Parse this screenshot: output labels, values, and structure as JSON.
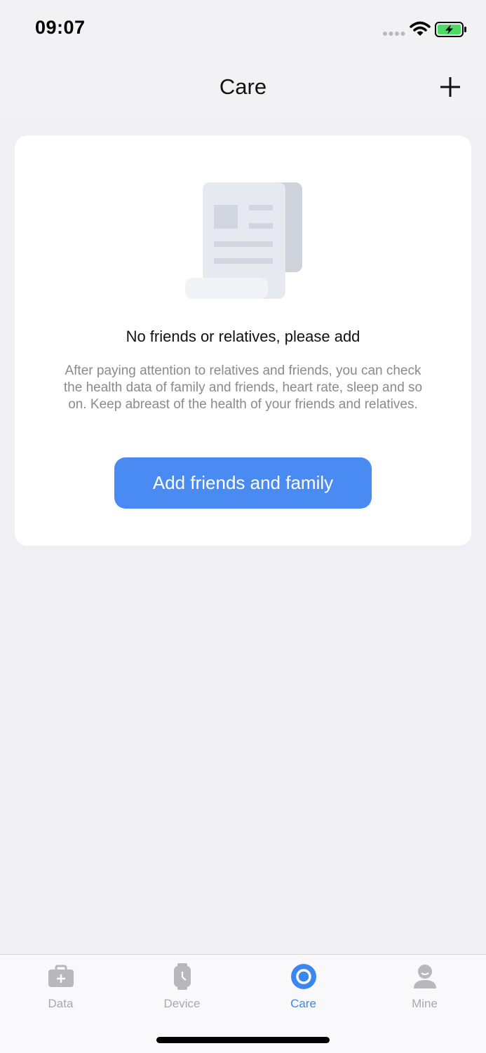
{
  "status_bar": {
    "time": "09:07",
    "icons": [
      "signal-icon",
      "wifi-icon",
      "battery-charging-icon"
    ]
  },
  "nav": {
    "title": "Care",
    "add_icon": "plus-icon"
  },
  "empty_state": {
    "illustration": "document-scroll-icon",
    "title": "No friends or relatives, please add",
    "description": "After paying attention to relatives and friends, you can check the health data of family and friends, heart rate, sleep and so on. Keep abreast of the health of your friends and relatives.",
    "button_label": "Add friends and family"
  },
  "tabs": [
    {
      "label": "Data",
      "icon": "medical-kit-icon",
      "active": false
    },
    {
      "label": "Device",
      "icon": "watch-icon",
      "active": false
    },
    {
      "label": "Care",
      "icon": "care-ring-icon",
      "active": true
    },
    {
      "label": "Mine",
      "icon": "person-icon",
      "active": false
    }
  ],
  "colors": {
    "accent": "#4a8bf3",
    "active_tab": "#3b86f0",
    "inactive_tab": "#a8a8ad",
    "background": "#efeff4",
    "battery": "#4cd964"
  }
}
